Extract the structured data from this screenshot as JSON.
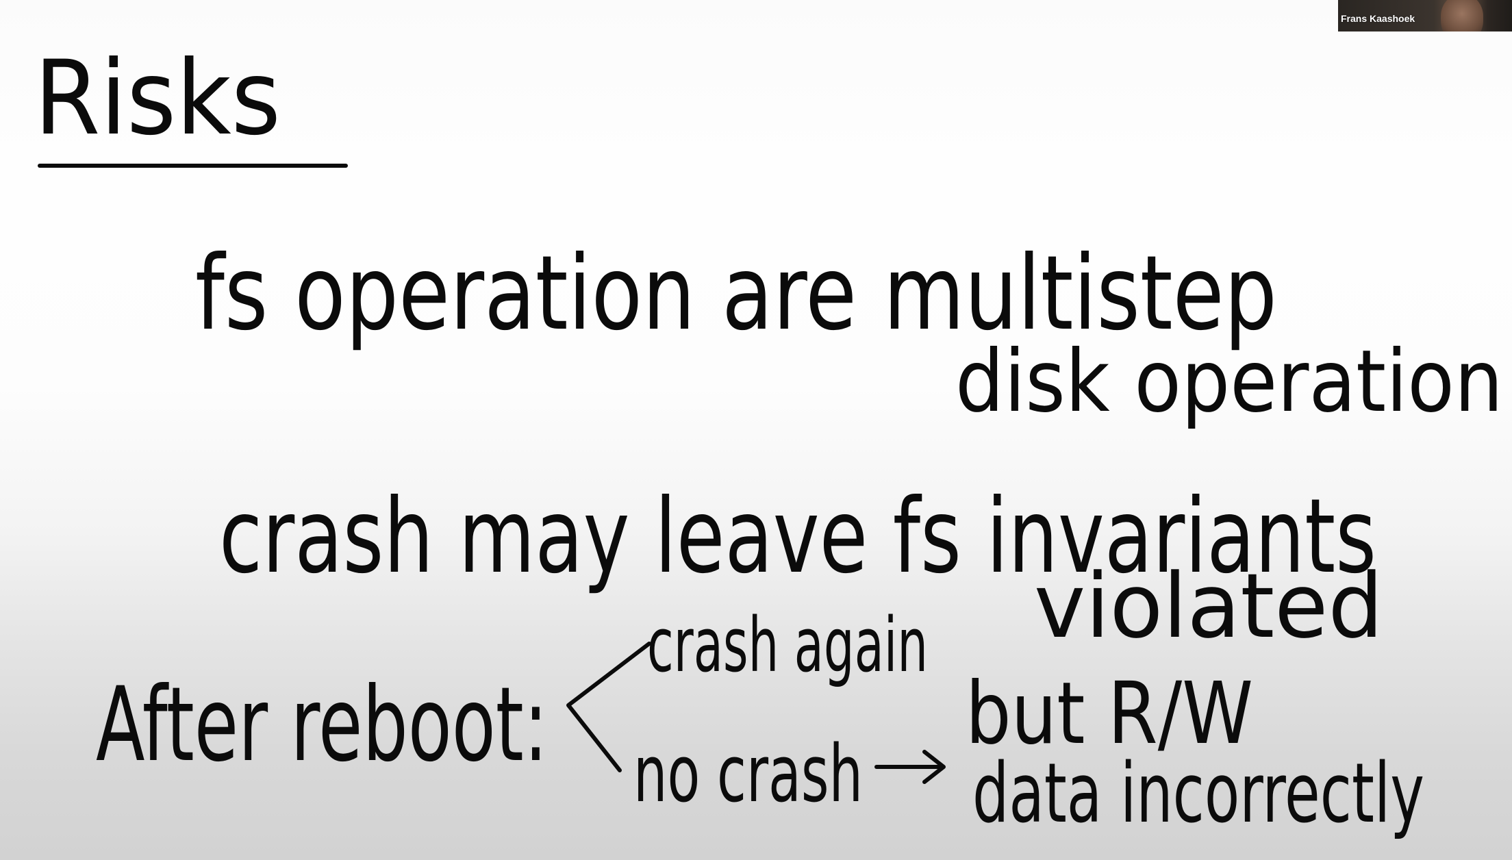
{
  "participant": {
    "name": "Frans Kaashoek"
  },
  "whiteboard": {
    "title": "Risks",
    "line1": "fs operation are multistep",
    "line1_sub": "disk operation",
    "line2": "crash may leave fs invariants",
    "line2_sub": "violated",
    "line3_label": "After reboot:",
    "branch_crash": "crash again",
    "branch_nocrash": "no crash",
    "result_line1": "but R/W",
    "result_line2": "data incorrectly",
    "ink_color": "#0b0b0b"
  }
}
